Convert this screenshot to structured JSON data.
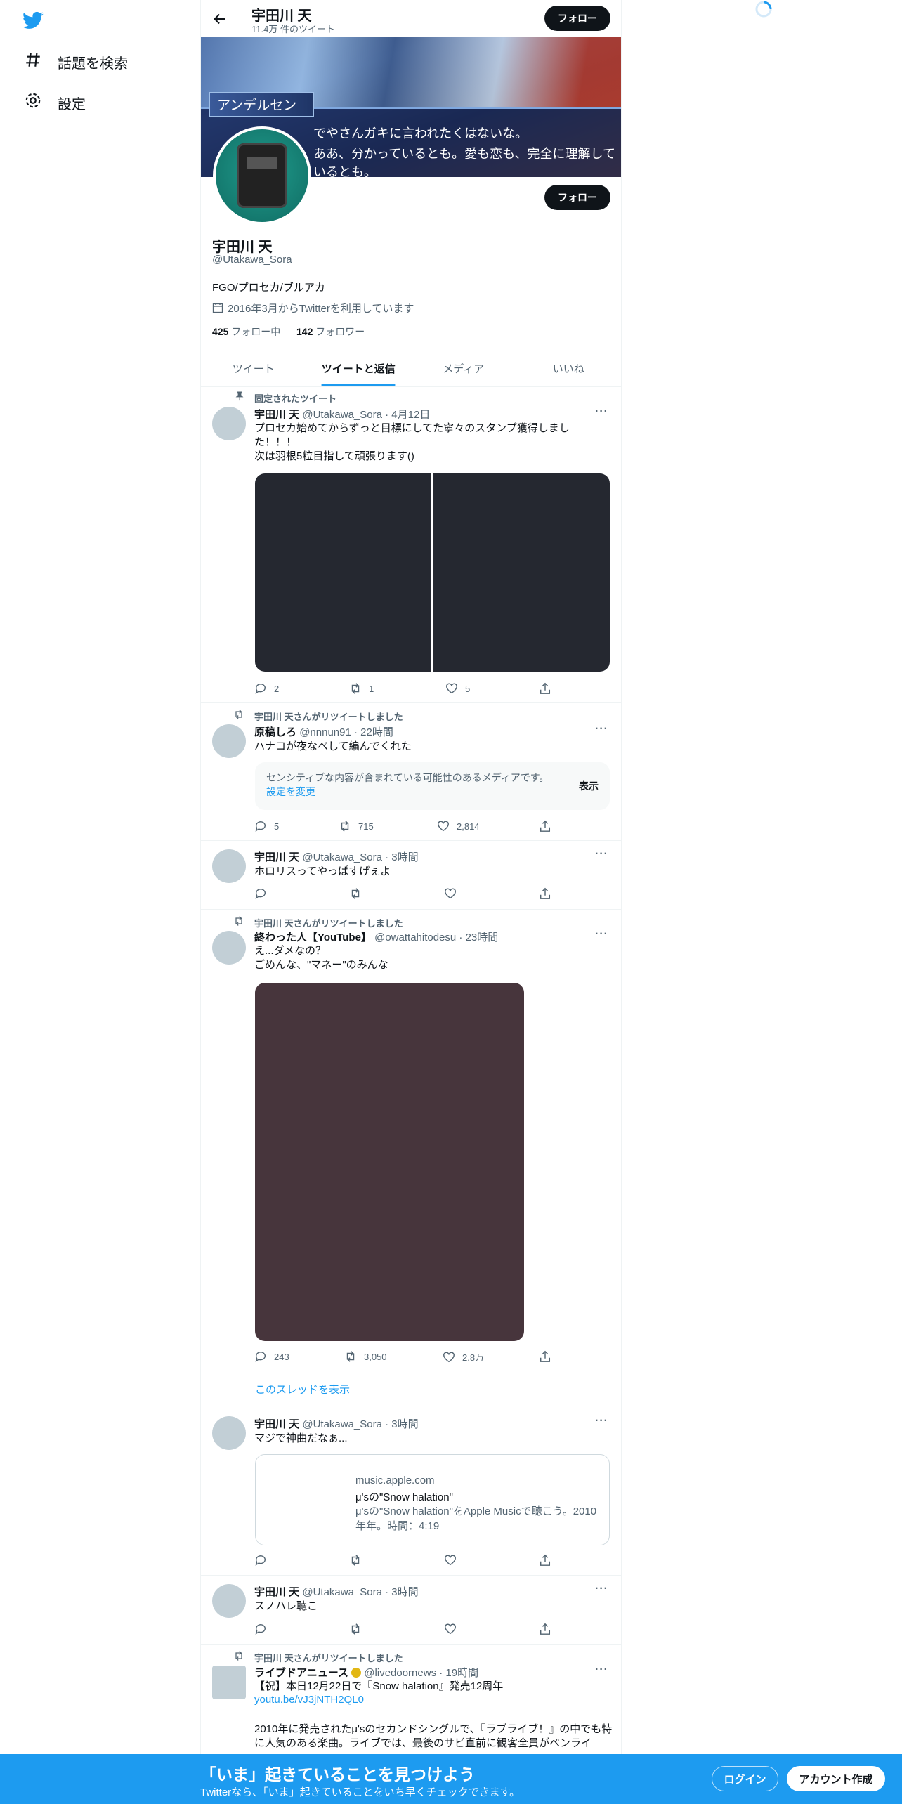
{
  "sidebar": {
    "explore_label": "話題を検索",
    "settings_label": "設定"
  },
  "header": {
    "name": "宇田川 天",
    "tweet_count": "11.4万 件のツイート",
    "follow_label": "フォロー"
  },
  "banner": {
    "caption_name": "アンデルセン",
    "caption_line1": "でやさんガキに言われたくはないな。",
    "caption_line2": "ああ、分かっているとも。愛も恋も、完全に理解しているとも。"
  },
  "profile": {
    "follow_label": "フォロー",
    "display_name": "宇田川 天",
    "handle": "@Utakawa_Sora",
    "bio": "FGO/プロセカ/ブルアカ",
    "joined": "2016年3月からTwitterを利用しています",
    "following_count": "425",
    "following_label": "フォロー中",
    "followers_count": "142",
    "followers_label": "フォロワー"
  },
  "tabs": [
    "ツイート",
    "ツイートと返信",
    "メディア",
    "いいね"
  ],
  "tweets": [
    {
      "context": "固定されたツイート",
      "name": "宇田川 天",
      "meta": "@Utakawa_Sora · 4月12日",
      "text": "プロセカ始めてからずっと目標にしてた寧々のスタンプ獲得しました！！！\n次は羽根5粒目指して頑張ります()",
      "replies": "2",
      "retweets": "1",
      "likes": "5"
    },
    {
      "context": "宇田川 天さんがリツイートしました",
      "name": "原稿しろ",
      "meta": "@nnnun91 · 22時間",
      "text": "ハナコが夜なべして編んでくれた",
      "sensitive_text": "センシティブな内容が含まれている可能性のあるメディアです。",
      "sensitive_link": "設定を変更",
      "show_label": "表示",
      "replies": "5",
      "retweets": "715",
      "likes": "2,814"
    },
    {
      "name": "宇田川 天",
      "meta": "@Utakawa_Sora · 3時間",
      "text": "ホロリスってやっぱすげぇよ"
    },
    {
      "context": "宇田川 天さんがリツイートしました",
      "name": "終わった人【YouTube】",
      "meta": "@owattahitodesu · 23時間",
      "text": "え...ダメなの？\nごめんな、\"マネー\"のみんな",
      "replies": "243",
      "retweets": "3,050",
      "likes": "2.8万",
      "thread_label": "このスレッドを表示"
    },
    {
      "name": "宇田川 天",
      "meta": "@Utakawa_Sora · 3時間",
      "text": "マジで神曲だなぁ...",
      "card_domain": "music.apple.com",
      "card_title": "μ'sの\"Snow halation\"",
      "card_desc": "μ'sの\"Snow halation\"をApple Musicで聴こう。2010年年。時間：4:19"
    },
    {
      "name": "宇田川 天",
      "meta": "@Utakawa_Sora · 3時間",
      "text": "スノハレ聴こ"
    },
    {
      "context": "宇田川 天さんがリツイートしました",
      "name": "ライブドアニュース",
      "meta": "@livedoornews · 19時間",
      "text": "【祝】本日12月22日で『Snow halation』発売12周年",
      "link": "youtu.be/vJ3jNTH2QL0",
      "text2": "2010年に発売されたμ'sのセカンドシングルで、『ラブライブ！』の中でも特に人気のある楽曲。ライブでは、最後のサビ直前に観客全員がペンライ"
    }
  ],
  "bottom_bar": {
    "title": "「いま」起きていることを見つけよう",
    "subtitle": "Twitterなら、「いま」起きていることをいち早くチェックできます。",
    "login_label": "ログイン",
    "signup_label": "アカウント作成"
  },
  "colors": {
    "accent": "#1d9bf0",
    "text": "#0f1419",
    "muted": "#536471"
  }
}
